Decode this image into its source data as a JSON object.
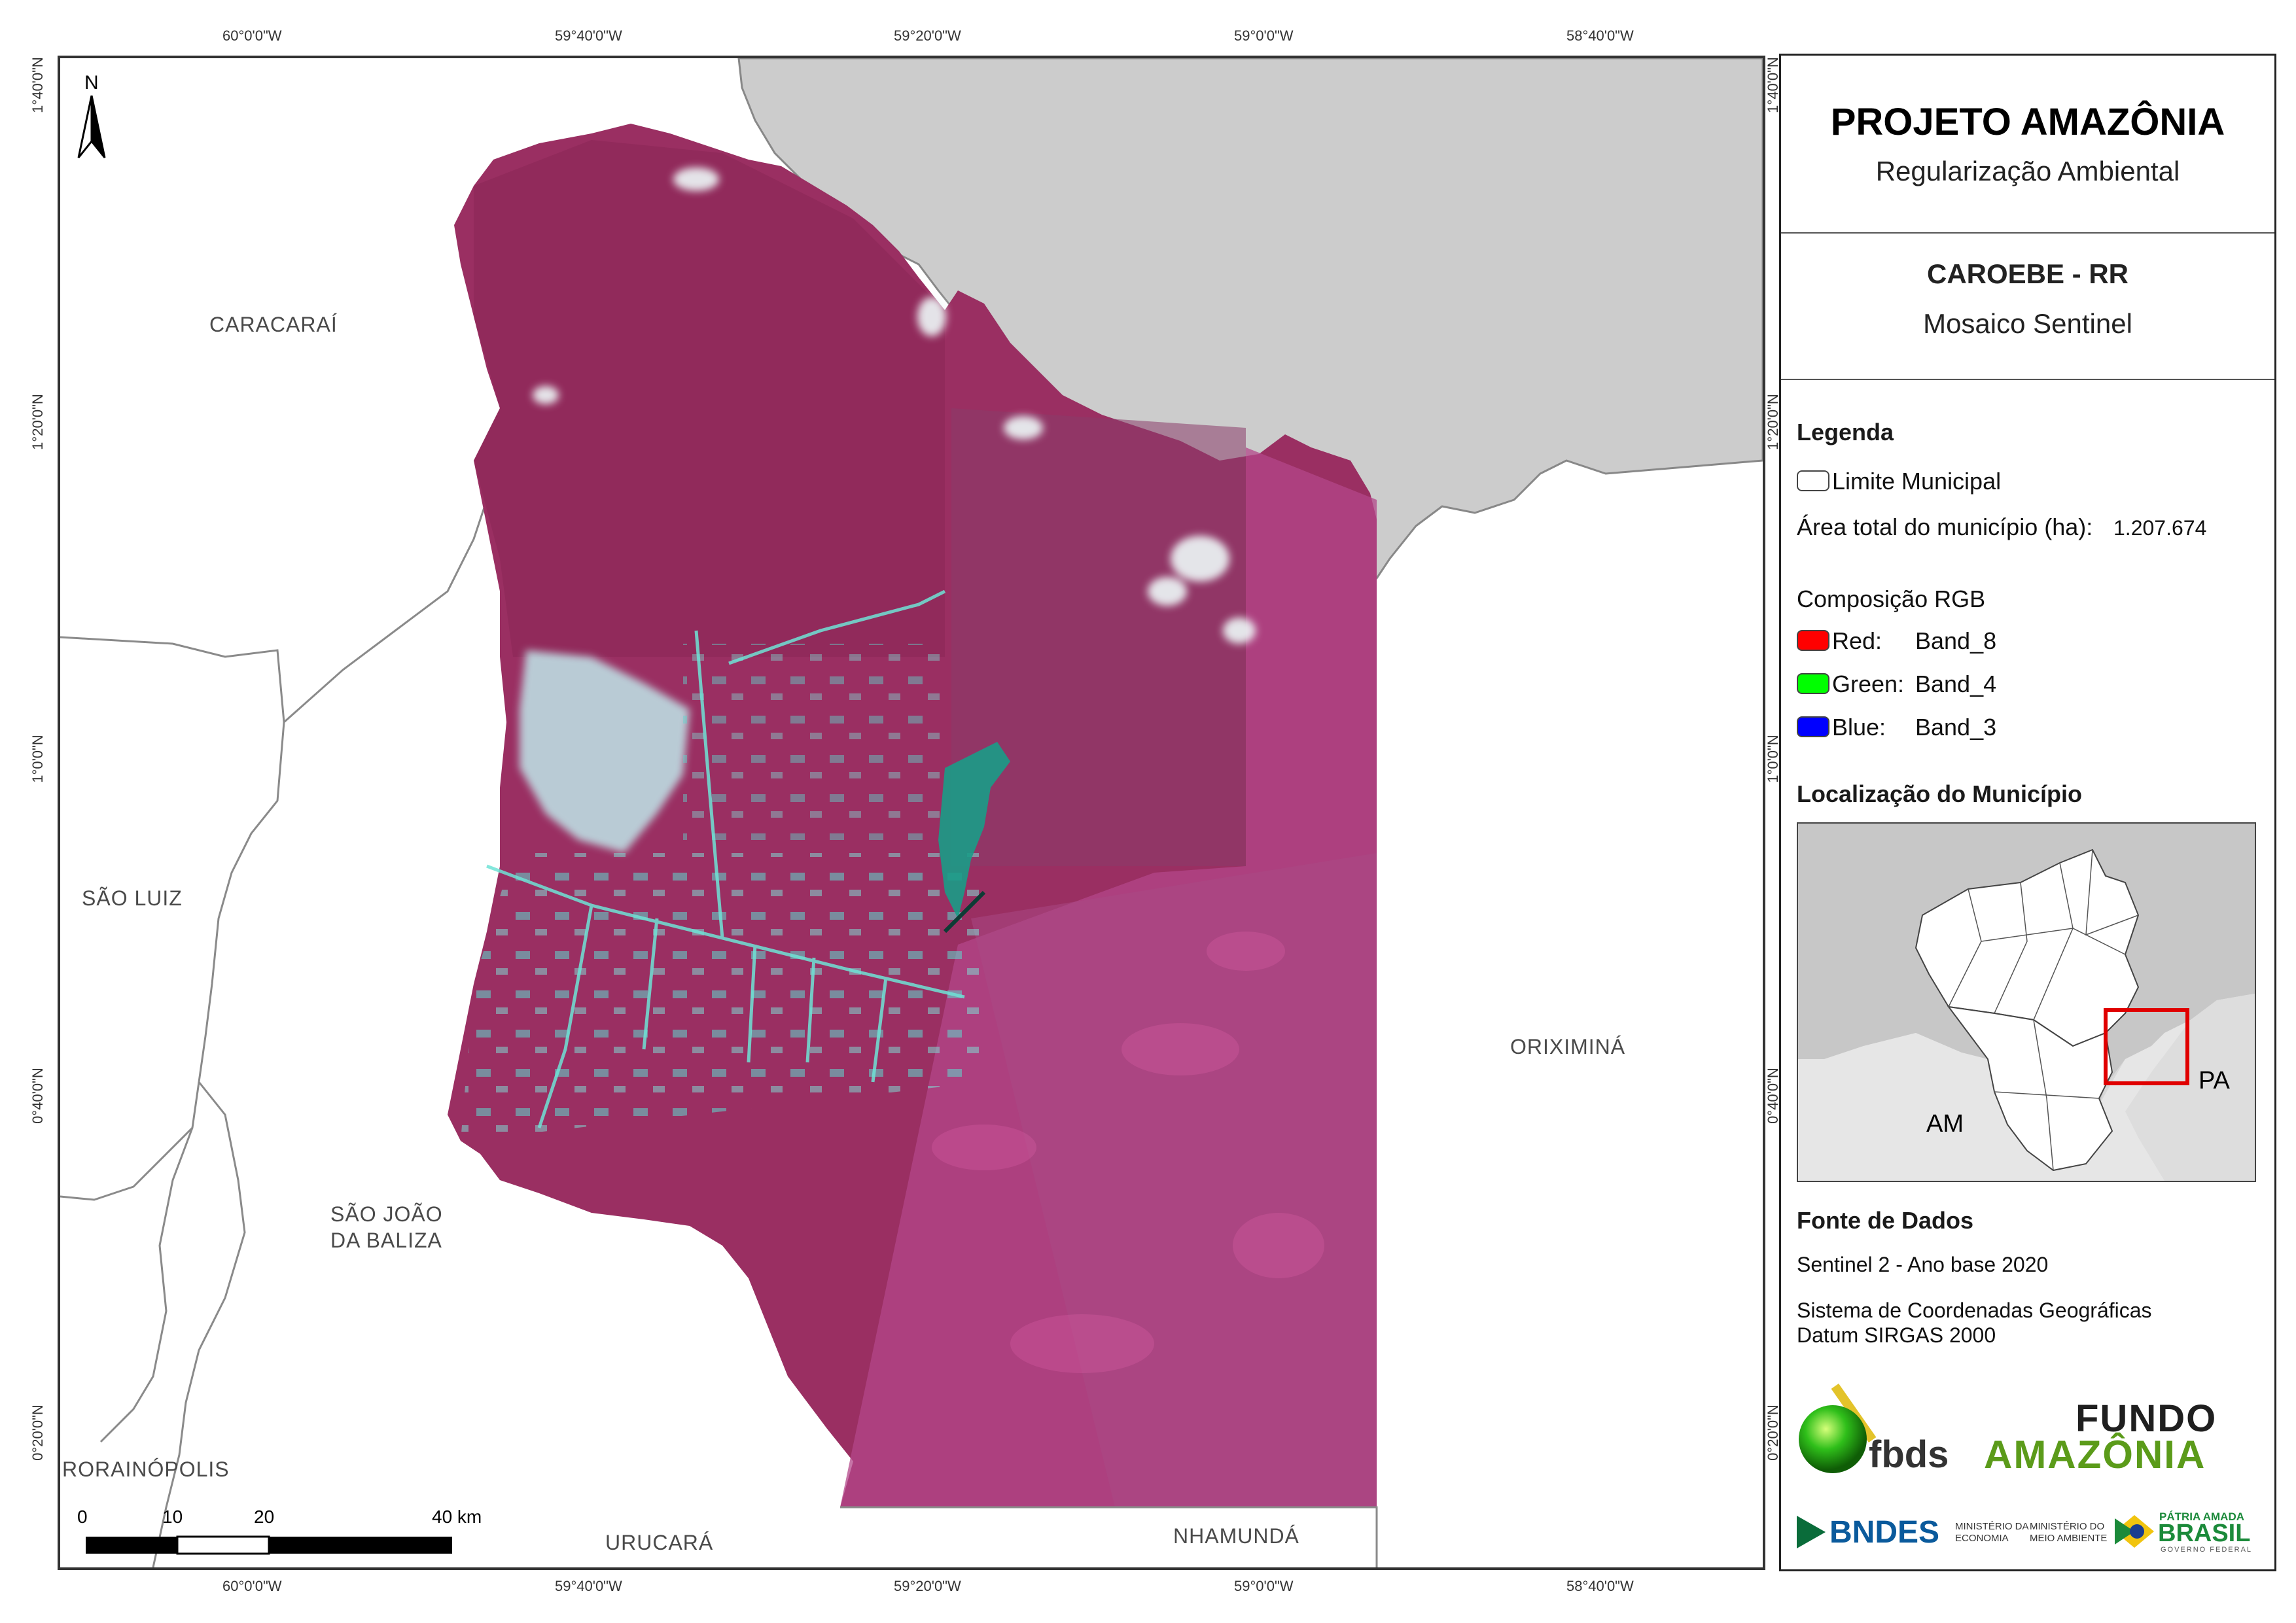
{
  "map": {
    "north_label": "N",
    "top_coords": [
      "60°0'0\"W",
      "59°40'0\"W",
      "59°20'0\"W",
      "59°0'0\"W",
      "58°40'0\"W"
    ],
    "bottom_coords": [
      "60°0'0\"W",
      "59°40'0\"W",
      "59°20'0\"W",
      "59°0'0\"W",
      "58°40'0\"W"
    ],
    "left_coords": [
      "1°40'0\"N",
      "1°20'0\"N",
      "1°0'0\"N",
      "0°40'0\"N",
      "0°20'0\"N"
    ],
    "right_coords": [
      "1°40'0\"N",
      "1°20'0\"N",
      "1°0'0\"N",
      "0°40'0\"N",
      "0°20'0\"N"
    ],
    "places": {
      "caracarai": "CARACARAÍ",
      "sao_luiz": "SÃO LUIZ",
      "sao_joao_1": "SÃO JOÃO",
      "sao_joao_2": "DA BALIZA",
      "rorainopolis": "RORAINÓPOLIS",
      "urucara": "URUCARÁ",
      "nhamunda": "NHAMUNDÁ",
      "oriximina": "ORIXIMINÁ"
    },
    "scale_labels": [
      "0",
      "10",
      "20",
      "40 km"
    ]
  },
  "legend": {
    "title": "PROJETO AMAZÔNIA",
    "subtitle": "Regularização Ambiental",
    "municipality": "CAROEBE - RR",
    "product": "Mosaico Sentinel",
    "legend_heading": "Legenda",
    "limit_label": "Limite Municipal",
    "area_label": "Área total do município (ha):",
    "area_value": "1.207.674",
    "rgb_heading": "Composição RGB",
    "bands": [
      {
        "channel": "Red:",
        "band": "Band_8",
        "color": "#ff0000"
      },
      {
        "channel": "Green:",
        "band": "Band_4",
        "color": "#00ff00"
      },
      {
        "channel": "Blue:",
        "band": "Band_3",
        "color": "#0000ff"
      }
    ],
    "location_heading": "Localização do Município",
    "inset_labels": {
      "am": "AM",
      "pa": "PA"
    },
    "sources_heading": "Fonte de Dados",
    "source_line": "Sentinel 2 - Ano base 2020",
    "crs_line1": "Sistema de Coordenadas Geográficas",
    "crs_line2": "Datum SIRGAS 2000",
    "logos": {
      "fbds": "fbds",
      "fundo_1": "FUNDO",
      "fundo_2": "AMAZÔNIA",
      "bndes": "BNDES",
      "min_economia_1": "MINISTÉRIO DA",
      "min_economia_2": "ECONOMIA",
      "min_ambiente_1": "MINISTÉRIO DO",
      "min_ambiente_2": "MEIO AMBIENTE",
      "patria_1": "PÁTRIA AMADA",
      "patria_2": "BRASIL",
      "patria_3": "GOVERNO FEDERAL"
    }
  },
  "colors": {
    "imagery": "#9a2f62",
    "outside_state": "#cccccc",
    "frame": "#333333",
    "locator_box": "#e00000"
  }
}
